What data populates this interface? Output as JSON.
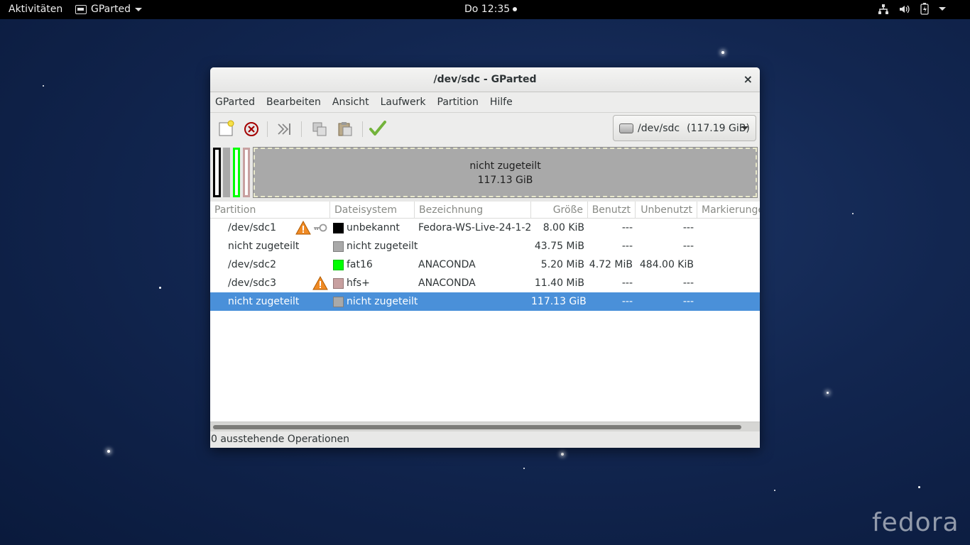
{
  "topbar": {
    "activities": "Aktivitäten",
    "app_name": "GParted",
    "clock": "Do 12:35",
    "tray_icons": [
      "network-icon",
      "volume-icon",
      "battery-icon"
    ]
  },
  "window": {
    "title": "/dev/sdc - GParted",
    "close": "×",
    "menu": [
      "GParted",
      "Bearbeiten",
      "Ansicht",
      "Laufwerk",
      "Partition",
      "Hilfe"
    ],
    "toolbar": {
      "icons": [
        "new-partition-icon",
        "delete-partition-icon",
        "resize-move-icon",
        "copy-icon",
        "paste-icon",
        "apply-icon"
      ]
    },
    "device": {
      "name": "/dev/sdc",
      "size": "(117.19 GiB)"
    },
    "map": {
      "label": "nicht zugeteilt",
      "size": "117.13 GiB"
    },
    "table": {
      "headers": [
        "Partition",
        "Dateisystem",
        "Bezeichnung",
        "Größe",
        "Benutzt",
        "Unbenutzt",
        "Markierungen"
      ],
      "rows": [
        {
          "partition": "/dev/sdc1",
          "warning": true,
          "key": true,
          "fs": "unbekannt",
          "fs_color": "#000000",
          "label": "Fedora-WS-Live-24-1-2",
          "size": "8.00 KiB",
          "used": "---",
          "unused": "---"
        },
        {
          "partition": "nicht zugeteilt",
          "warning": false,
          "key": false,
          "fs": "nicht zugeteilt",
          "fs_color": "#a9a9a9",
          "label": "",
          "size": "43.75 MiB",
          "used": "---",
          "unused": "---"
        },
        {
          "partition": "/dev/sdc2",
          "warning": false,
          "key": false,
          "fs": "fat16",
          "fs_color": "#00ff00",
          "label": "ANACONDA",
          "size": "5.20 MiB",
          "used": "4.72 MiB",
          "unused": "484.00 KiB"
        },
        {
          "partition": "/dev/sdc3",
          "warning": true,
          "key": false,
          "fs": "hfs+",
          "fs_color": "#c8a0a0",
          "label": "ANACONDA",
          "size": "11.40 MiB",
          "used": "---",
          "unused": "---"
        },
        {
          "partition": "nicht zugeteilt",
          "warning": false,
          "key": false,
          "fs": "nicht zugeteilt",
          "fs_color": "#a9a9a9",
          "label": "",
          "size": "117.13 GiB",
          "used": "---",
          "unused": "---",
          "selected": true
        }
      ]
    },
    "status": "0 ausstehende Operationen"
  },
  "desktop": {
    "logo": "fedora"
  },
  "colors": {
    "selection": "#4a90d9",
    "topbar": "#000000"
  }
}
